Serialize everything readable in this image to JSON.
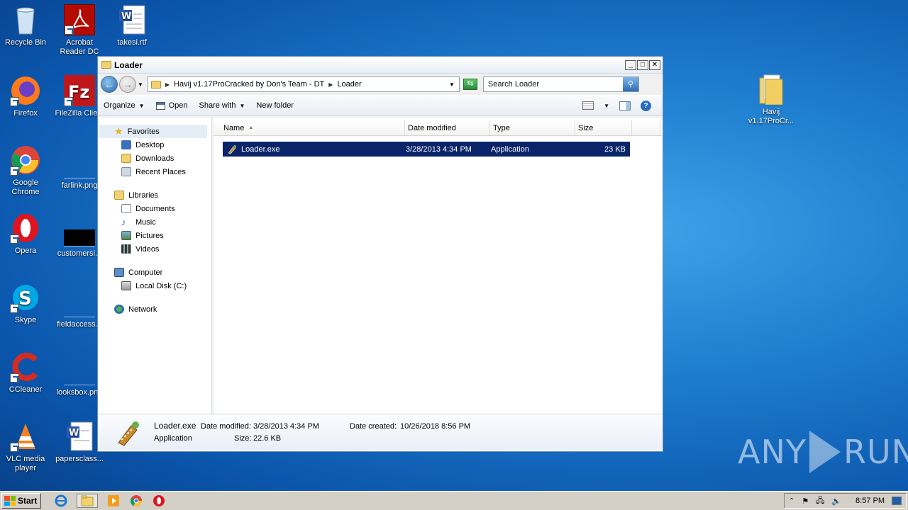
{
  "desktop": {
    "icons": [
      {
        "label": "Recycle Bin"
      },
      {
        "label": "Acrobat Reader DC"
      },
      {
        "label": "takesi.rtf"
      },
      {
        "label": "Firefox"
      },
      {
        "label": "FileZilla Client"
      },
      {
        "label": "Google Chrome"
      },
      {
        "label": "farlink.png"
      },
      {
        "label": "Opera"
      },
      {
        "label": "customersi..."
      },
      {
        "label": "Skype"
      },
      {
        "label": "fieldaccess..."
      },
      {
        "label": "CCleaner"
      },
      {
        "label": "looksbox.png"
      },
      {
        "label": "VLC media player"
      },
      {
        "label": "papersclass..."
      },
      {
        "label": "Havij v1.17ProCr..."
      }
    ]
  },
  "window": {
    "title": "Loader",
    "address": {
      "crumbs": [
        "Havij v1.17ProCracked by Don's Team - DT",
        "Loader"
      ]
    },
    "search_placeholder": "Search Loader",
    "toolbar": {
      "organize": "Organize",
      "open": "Open",
      "share_with": "Share with",
      "new_folder": "New folder"
    },
    "nav": {
      "favorites": "Favorites",
      "desktop": "Desktop",
      "downloads": "Downloads",
      "recent_places": "Recent Places",
      "libraries": "Libraries",
      "documents": "Documents",
      "music": "Music",
      "pictures": "Pictures",
      "videos": "Videos",
      "computer": "Computer",
      "local_disk": "Local Disk (C:)",
      "network": "Network"
    },
    "columns": [
      "Name",
      "Date modified",
      "Type",
      "Size"
    ],
    "files": [
      {
        "name": "Loader.exe",
        "date_modified": "3/28/2013 4:34 PM",
        "type": "Application",
        "size": "23 KB"
      }
    ],
    "details": {
      "filename": "Loader.exe",
      "type": "Application",
      "date_modified_label": "Date modified:",
      "date_modified": "3/28/2013 4:34 PM",
      "date_created_label": "Date created:",
      "date_created": "10/26/2018 8:56 PM",
      "size_label": "Size:",
      "size": "22.6 KB"
    }
  },
  "taskbar": {
    "start_label": "Start",
    "clock": "8:57 PM"
  },
  "watermark": {
    "left": "ANY",
    "right": "RUN"
  },
  "colors": {
    "selection": "#0a246a",
    "desktop": "#1f7fd0",
    "taskbar": "#d4d0c8"
  }
}
